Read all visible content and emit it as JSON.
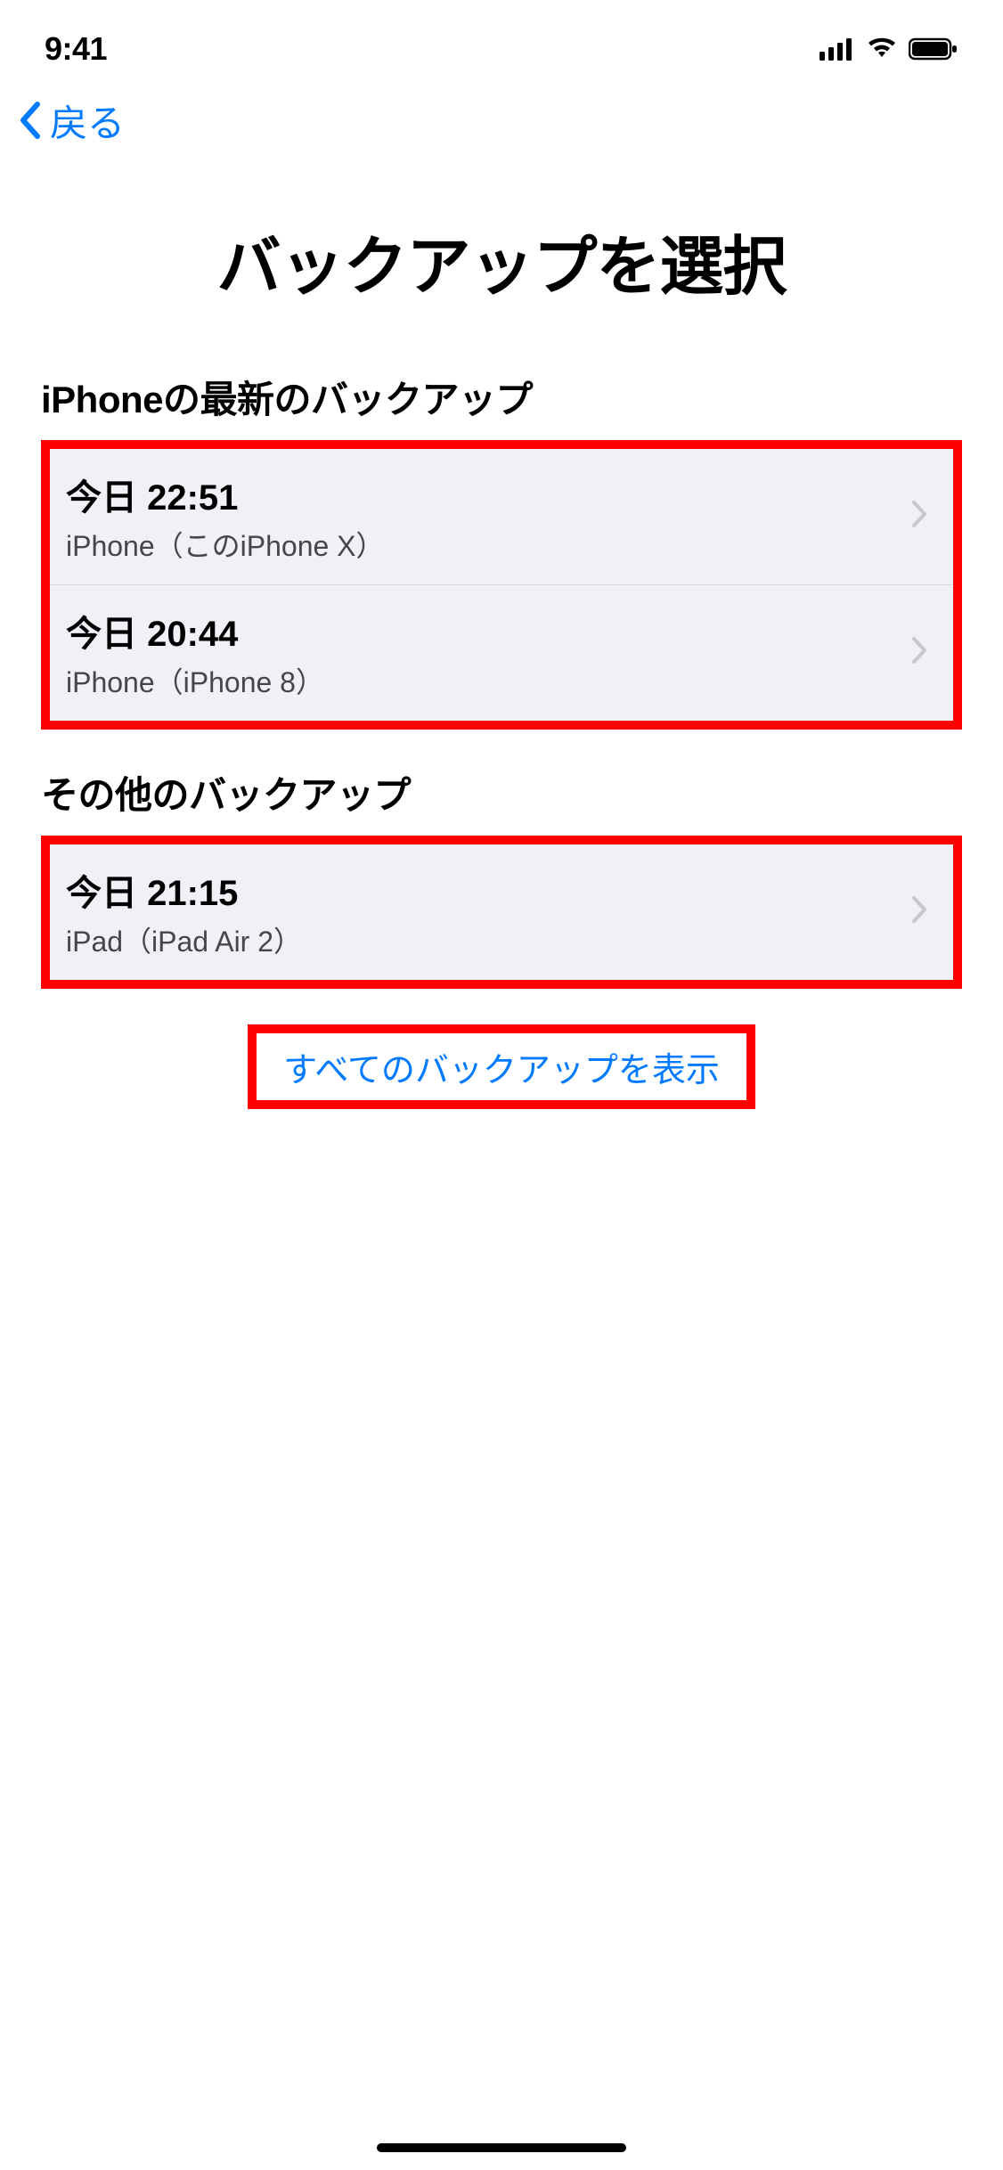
{
  "status_bar": {
    "time": "9:41"
  },
  "nav": {
    "back_label": "戻る"
  },
  "title": "バックアップを選択",
  "sections": {
    "latest": {
      "header": "iPhoneの最新のバックアップ",
      "items": [
        {
          "timestamp": "今日 22:51",
          "device": "iPhone（このiPhone X）"
        },
        {
          "timestamp": "今日 20:44",
          "device": "iPhone（iPhone 8）"
        }
      ]
    },
    "other": {
      "header": "その他のバックアップ",
      "items": [
        {
          "timestamp": "今日 21:15",
          "device": "iPad（iPad Air 2）"
        }
      ]
    }
  },
  "show_all_label": "すべてのバックアップを表示"
}
